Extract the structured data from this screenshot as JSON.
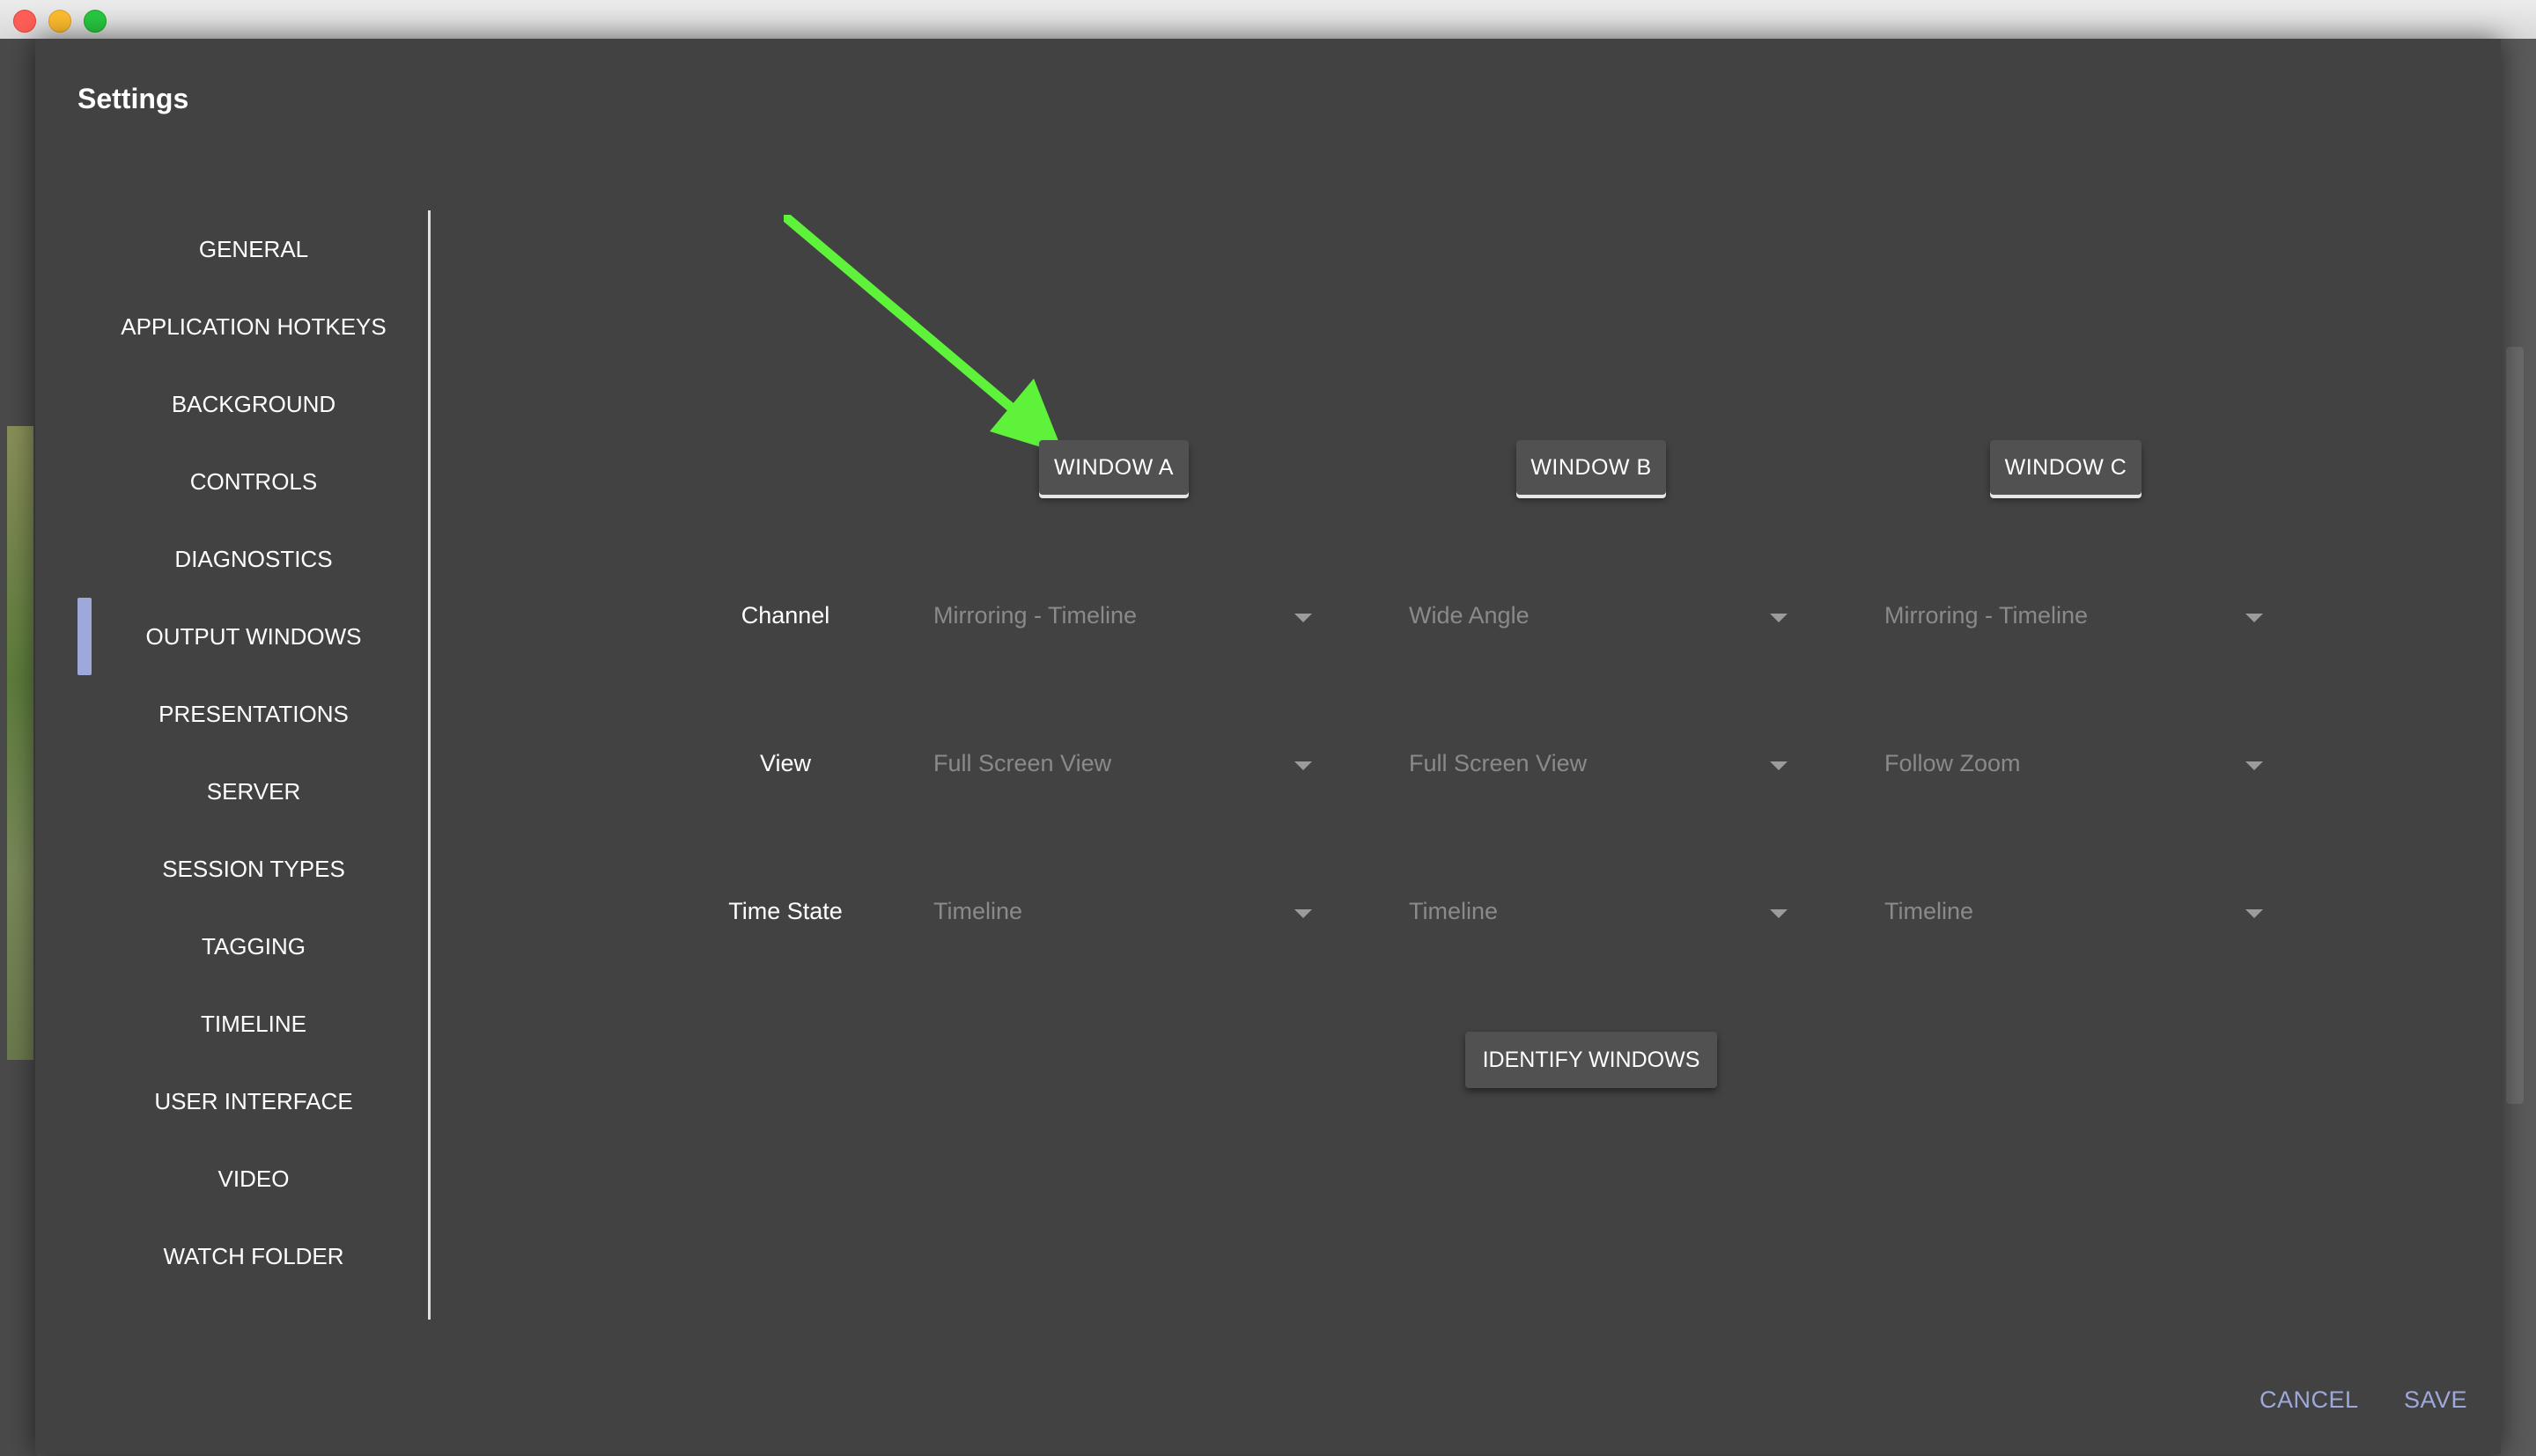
{
  "window": {
    "title": "Settings"
  },
  "colors": {
    "accent": "#9fa8da",
    "arrow": "#5ef23b",
    "dialog_bg": "#424242"
  },
  "nav": {
    "items": [
      {
        "label": "GENERAL"
      },
      {
        "label": "APPLICATION HOTKEYS"
      },
      {
        "label": "BACKGROUND"
      },
      {
        "label": "CONTROLS"
      },
      {
        "label": "DIAGNOSTICS"
      },
      {
        "label": "OUTPUT WINDOWS",
        "active": true
      },
      {
        "label": "PRESENTATIONS"
      },
      {
        "label": "SERVER"
      },
      {
        "label": "SESSION TYPES"
      },
      {
        "label": "TAGGING"
      },
      {
        "label": "TIMELINE"
      },
      {
        "label": "USER INTERFACE"
      },
      {
        "label": "VIDEO"
      },
      {
        "label": "WATCH FOLDER"
      }
    ]
  },
  "output_windows": {
    "windows": [
      {
        "label": "WINDOW A",
        "channel": "Mirroring - Timeline",
        "view": "Full Screen View",
        "time_state": "Timeline"
      },
      {
        "label": "WINDOW B",
        "channel": "Wide Angle",
        "view": "Full Screen View",
        "time_state": "Timeline"
      },
      {
        "label": "WINDOW C",
        "channel": "Mirroring - Timeline",
        "view": "Follow Zoom",
        "time_state": "Timeline"
      }
    ],
    "row_labels": {
      "channel": "Channel",
      "view": "View",
      "time_state": "Time State"
    },
    "identify_label": "IDENTIFY WINDOWS"
  },
  "footer": {
    "cancel_label": "CANCEL",
    "save_label": "SAVE"
  }
}
